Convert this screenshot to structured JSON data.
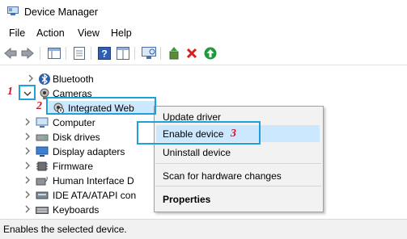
{
  "window": {
    "title": "Device Manager"
  },
  "menu": {
    "items": [
      "File",
      "Action",
      "View",
      "Help"
    ]
  },
  "tree": {
    "bluetooth": "Bluetooth",
    "cameras": "Cameras",
    "camera_device": "Integrated Web",
    "computer": "Computer",
    "disk_drives": "Disk drives",
    "display_adapters": "Display adapters",
    "firmware": "Firmware",
    "hid": "Human Interface D",
    "ide": "IDE ATA/ATAPI con",
    "keyboards": "Keyboards"
  },
  "context_menu": {
    "update_driver": "Update driver",
    "enable_device": "Enable device",
    "uninstall_device": "Uninstall device",
    "scan": "Scan for hardware changes",
    "properties": "Properties"
  },
  "callouts": {
    "step1": "1",
    "step2": "2",
    "step3": "3"
  },
  "status": {
    "text": "Enables the selected device."
  },
  "colors": {
    "callout_border": "#1f9fdc",
    "callout_number": "#d2142b",
    "menu_bg": "#f2f2f2"
  }
}
